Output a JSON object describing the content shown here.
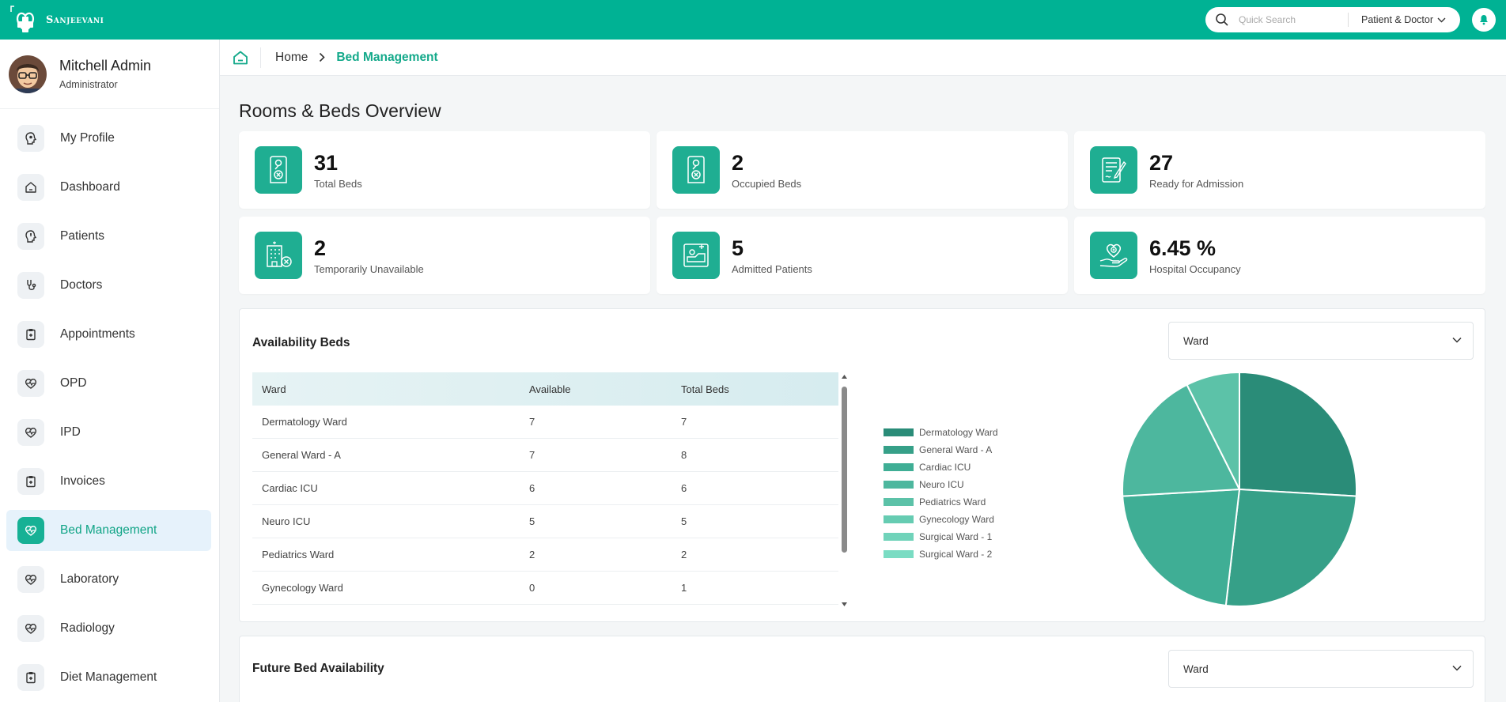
{
  "brand": {
    "name": "Sanjeevani"
  },
  "search": {
    "placeholder": "Quick Search",
    "scope": "Patient & Doctor"
  },
  "user": {
    "name": "Mitchell Admin",
    "role": "Administrator"
  },
  "sidebar": {
    "items": [
      {
        "label": "My Profile",
        "icon": "profile-icon",
        "active": false
      },
      {
        "label": "Dashboard",
        "icon": "home-icon",
        "active": false
      },
      {
        "label": "Patients",
        "icon": "patient-head-icon",
        "active": false
      },
      {
        "label": "Doctors",
        "icon": "stethoscope-icon",
        "active": false
      },
      {
        "label": "Appointments",
        "icon": "clipboard-plus-icon",
        "active": false
      },
      {
        "label": "OPD",
        "icon": "heartbeat-icon",
        "active": false
      },
      {
        "label": "IPD",
        "icon": "heartbeat-icon",
        "active": false
      },
      {
        "label": "Invoices",
        "icon": "clipboard-plus-icon",
        "active": false
      },
      {
        "label": "Bed Management",
        "icon": "heartbeat-icon",
        "active": true
      },
      {
        "label": "Laboratory",
        "icon": "heartbeat-icon",
        "active": false
      },
      {
        "label": "Radiology",
        "icon": "heartbeat-icon",
        "active": false
      },
      {
        "label": "Diet Management",
        "icon": "clipboard-plus-icon",
        "active": false
      }
    ]
  },
  "breadcrumb": {
    "home": "Home",
    "current": "Bed Management"
  },
  "page": {
    "title": "Rooms & Beds Overview"
  },
  "stats": [
    {
      "value": "31",
      "label": "Total Beds",
      "icon": "door-hanger-icon"
    },
    {
      "value": "2",
      "label": "Occupied Beds",
      "icon": "door-hanger-icon"
    },
    {
      "value": "27",
      "label": "Ready for Admission",
      "icon": "form-pen-icon"
    },
    {
      "value": "2",
      "label": "Temporarily Unavailable",
      "icon": "hospital-building-icon"
    },
    {
      "value": "5",
      "label": "Admitted Patients",
      "icon": "patient-bed-icon"
    },
    {
      "value": "6.45 %",
      "label": "Hospital Occupancy",
      "icon": "hand-heart-icon"
    }
  ],
  "availability": {
    "title": "Availability Beds",
    "filter": "Ward",
    "columns": [
      "Ward",
      "Available",
      "Total Beds"
    ],
    "rows": [
      [
        "Dermatology Ward",
        "7",
        "7"
      ],
      [
        "General Ward - A",
        "7",
        "8"
      ],
      [
        "Cardiac ICU",
        "6",
        "6"
      ],
      [
        "Neuro ICU",
        "5",
        "5"
      ],
      [
        "Pediatrics Ward",
        "2",
        "2"
      ],
      [
        "Gynecology Ward",
        "0",
        "1"
      ]
    ]
  },
  "future": {
    "title": "Future Bed Availability",
    "filter": "Ward"
  },
  "chart_data": {
    "type": "pie",
    "categories": [
      "Dermatology Ward",
      "General Ward - A",
      "Cardiac ICU",
      "Neuro ICU",
      "Pediatrics Ward",
      "Gynecology Ward",
      "Surgical Ward - 1",
      "Surgical Ward - 2"
    ],
    "values": [
      7,
      7,
      6,
      5,
      2,
      0,
      0,
      0
    ],
    "colors": [
      "#2a8c78",
      "#36a088",
      "#3fae95",
      "#4db79e",
      "#5cc2a8",
      "#66ccb2",
      "#70d3ba",
      "#7adcc3"
    ],
    "legend": "left"
  }
}
